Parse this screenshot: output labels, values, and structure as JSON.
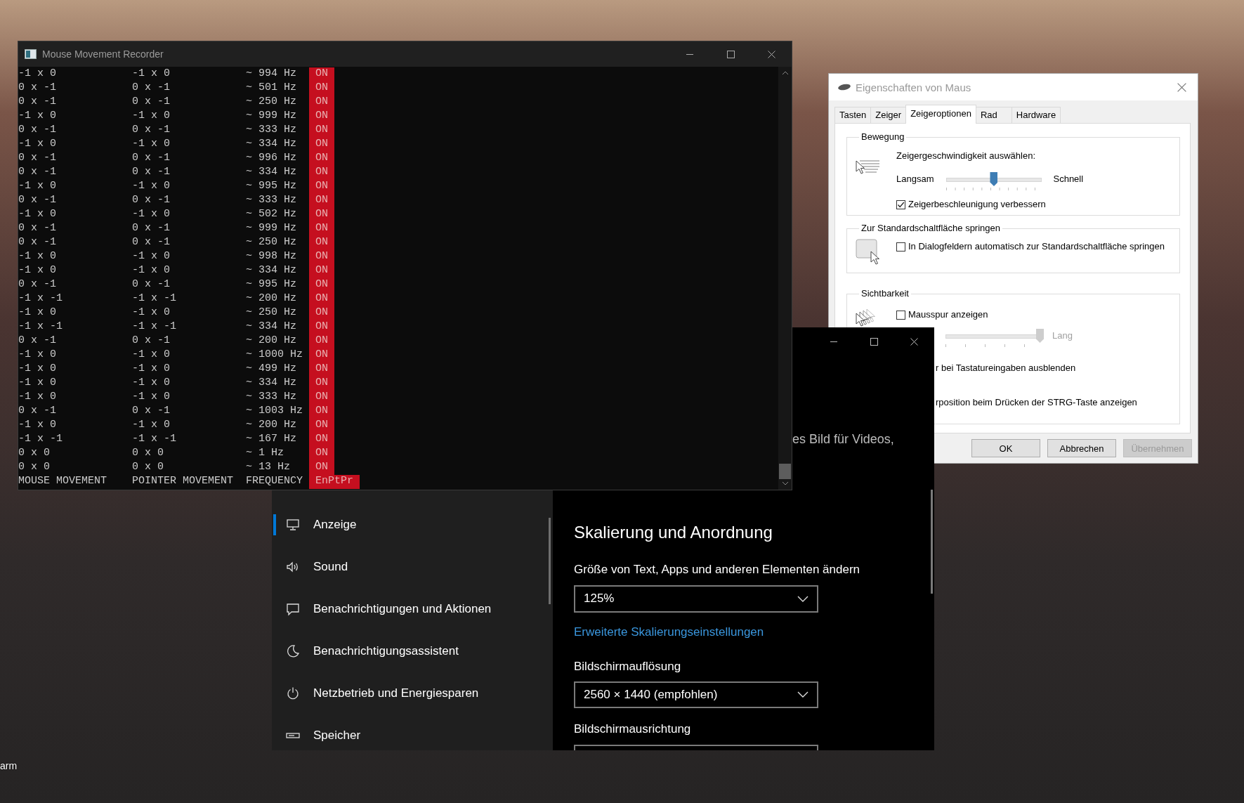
{
  "desktop": {
    "icon_label": "arm"
  },
  "console": {
    "title": "Mouse Movement Recorder",
    "rows": [
      {
        "mouse": "-1 x 0",
        "pointer": "-1 x 0",
        "frequency": "~ 994 Hz",
        "flag": "ON"
      },
      {
        "mouse": "0 x -1",
        "pointer": "0 x -1",
        "frequency": "~ 501 Hz",
        "flag": "ON"
      },
      {
        "mouse": "0 x -1",
        "pointer": "0 x -1",
        "frequency": "~ 250 Hz",
        "flag": "ON"
      },
      {
        "mouse": "-1 x 0",
        "pointer": "-1 x 0",
        "frequency": "~ 999 Hz",
        "flag": "ON"
      },
      {
        "mouse": "0 x -1",
        "pointer": "0 x -1",
        "frequency": "~ 333 Hz",
        "flag": "ON"
      },
      {
        "mouse": "-1 x 0",
        "pointer": "-1 x 0",
        "frequency": "~ 334 Hz",
        "flag": "ON"
      },
      {
        "mouse": "0 x -1",
        "pointer": "0 x -1",
        "frequency": "~ 996 Hz",
        "flag": "ON"
      },
      {
        "mouse": "0 x -1",
        "pointer": "0 x -1",
        "frequency": "~ 334 Hz",
        "flag": "ON"
      },
      {
        "mouse": "-1 x 0",
        "pointer": "-1 x 0",
        "frequency": "~ 995 Hz",
        "flag": "ON"
      },
      {
        "mouse": "0 x -1",
        "pointer": "0 x -1",
        "frequency": "~ 333 Hz",
        "flag": "ON"
      },
      {
        "mouse": "-1 x 0",
        "pointer": "-1 x 0",
        "frequency": "~ 502 Hz",
        "flag": "ON"
      },
      {
        "mouse": "0 x -1",
        "pointer": "0 x -1",
        "frequency": "~ 999 Hz",
        "flag": "ON"
      },
      {
        "mouse": "0 x -1",
        "pointer": "0 x -1",
        "frequency": "~ 250 Hz",
        "flag": "ON"
      },
      {
        "mouse": "-1 x 0",
        "pointer": "-1 x 0",
        "frequency": "~ 998 Hz",
        "flag": "ON"
      },
      {
        "mouse": "-1 x 0",
        "pointer": "-1 x 0",
        "frequency": "~ 334 Hz",
        "flag": "ON"
      },
      {
        "mouse": "0 x -1",
        "pointer": "0 x -1",
        "frequency": "~ 995 Hz",
        "flag": "ON"
      },
      {
        "mouse": "-1 x -1",
        "pointer": "-1 x -1",
        "frequency": "~ 200 Hz",
        "flag": "ON"
      },
      {
        "mouse": "-1 x 0",
        "pointer": "-1 x 0",
        "frequency": "~ 250 Hz",
        "flag": "ON"
      },
      {
        "mouse": "-1 x -1",
        "pointer": "-1 x -1",
        "frequency": "~ 334 Hz",
        "flag": "ON"
      },
      {
        "mouse": "0 x -1",
        "pointer": "0 x -1",
        "frequency": "~ 200 Hz",
        "flag": "ON"
      },
      {
        "mouse": "-1 x 0",
        "pointer": "-1 x 0",
        "frequency": "~ 1000 Hz",
        "flag": "ON"
      },
      {
        "mouse": "-1 x 0",
        "pointer": "-1 x 0",
        "frequency": "~ 499 Hz",
        "flag": "ON"
      },
      {
        "mouse": "-1 x 0",
        "pointer": "-1 x 0",
        "frequency": "~ 334 Hz",
        "flag": "ON"
      },
      {
        "mouse": "-1 x 0",
        "pointer": "-1 x 0",
        "frequency": "~ 333 Hz",
        "flag": "ON"
      },
      {
        "mouse": "0 x -1",
        "pointer": "0 x -1",
        "frequency": "~ 1003 Hz",
        "flag": "ON"
      },
      {
        "mouse": "-1 x 0",
        "pointer": "-1 x 0",
        "frequency": "~ 200 Hz",
        "flag": "ON"
      },
      {
        "mouse": "-1 x -1",
        "pointer": "-1 x -1",
        "frequency": "~ 167 Hz",
        "flag": "ON"
      },
      {
        "mouse": "0 x 0",
        "pointer": "0 x 0",
        "frequency": "~ 1 Hz",
        "flag": "ON"
      },
      {
        "mouse": "0 x 0",
        "pointer": "0 x 0",
        "frequency": "~ 13 Hz",
        "flag": "ON"
      }
    ],
    "footer": {
      "mouse": "MOUSE MOVEMENT",
      "pointer": "POINTER MOVEMENT",
      "frequency": "FREQUENCY",
      "flag": "EnPtPr"
    }
  },
  "mouse_properties": {
    "title": "Eigenschaften von Maus",
    "tabs": [
      {
        "label": "Tasten",
        "selected": false
      },
      {
        "label": "Zeiger",
        "selected": false
      },
      {
        "label": "Zeigeroptionen",
        "selected": true
      },
      {
        "label": "Rad",
        "selected": false
      },
      {
        "label": "Hardware",
        "selected": false
      }
    ],
    "motion": {
      "title": "Bewegung",
      "label": "Zeigergeschwindigkeit auswählen:",
      "slow": "Langsam",
      "fast": "Schnell",
      "level": 0.5,
      "checkbox": {
        "label": "Zeigerbeschleunigung verbessern",
        "checked": true
      }
    },
    "snap": {
      "title": "Zur Standardschaltfläche springen",
      "checkbox": {
        "label": "In Dialogfeldern automatisch zur Standardschaltfläche springen",
        "checked": false
      }
    },
    "visibility": {
      "title": "Sichtbarkeit",
      "trails": {
        "label": "Mausspur anzeigen",
        "checked": false
      },
      "trail_slider": {
        "long": "Lang",
        "level": 1,
        "disabled": true
      },
      "hide_text": "r bei Tastatureingaben ausblenden",
      "show_location_text": "rposition beim Drücken der STRG-Taste anzeigen"
    },
    "buttons": [
      {
        "label": "OK",
        "disabled": false
      },
      {
        "label": "Abbrechen",
        "disabled": false
      },
      {
        "label": "Übernehmen",
        "disabled": true
      }
    ]
  },
  "settings": {
    "partial_text": "es Bild für Videos,",
    "nav": [
      {
        "label": "Anzeige",
        "selected": true
      },
      {
        "label": "Sound",
        "selected": false
      },
      {
        "label": "Benachrichtigungen und Aktionen",
        "selected": false
      },
      {
        "label": "Benachrichtigungsassistent",
        "selected": false
      },
      {
        "label": "Netzbetrieb und Energiesparen",
        "selected": false
      },
      {
        "label": "Speicher",
        "selected": false
      }
    ],
    "content": {
      "heading": "Skalierung und Anordnung",
      "scale_label": "Größe von Text, Apps und anderen Elementen ändern",
      "scale_value": "125%",
      "link": "Erweiterte Skalierungseinstellungen",
      "resolution_label": "Bildschirmauflösung",
      "resolution_value": "2560 × 1440 (empfohlen)",
      "orientation_label": "Bildschirmausrichtung"
    }
  }
}
